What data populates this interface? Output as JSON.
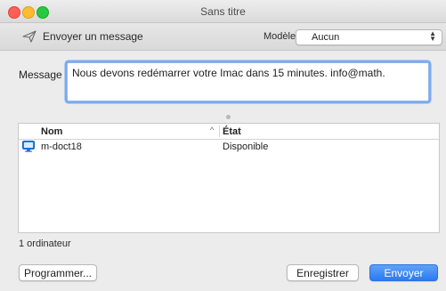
{
  "window": {
    "title": "Sans titre"
  },
  "toolbar": {
    "send_label": "Envoyer un message",
    "template_label": "Modèle :",
    "template_value": "Aucun"
  },
  "message": {
    "label": "Message :",
    "value": "Nous devons redémarrer votre Imac dans 15 minutes. info@math."
  },
  "table": {
    "columns": [
      "Nom",
      "État"
    ],
    "rows": [
      {
        "name": "m-doct18",
        "state": "Disponible",
        "icon": "computer-icon"
      }
    ]
  },
  "footer": {
    "count": "1 ordinateur",
    "schedule_label": "Programmer...",
    "save_label": "Enregistrer",
    "send_label": "Envoyer"
  },
  "colors": {
    "accent": "#2a7af2",
    "focus_ring": "#7daaf3",
    "close": "#fd5f57",
    "minimize": "#febc2e",
    "maximize": "#28c840"
  }
}
